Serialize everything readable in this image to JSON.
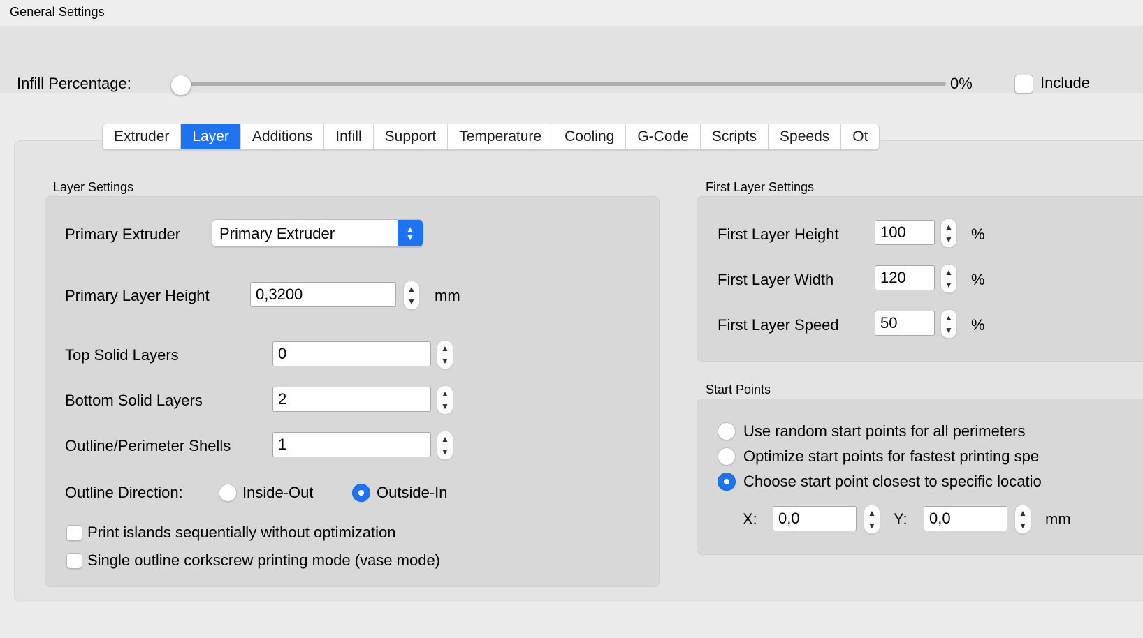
{
  "window": {
    "title": "General Settings"
  },
  "infill": {
    "label": "Infill Percentage:",
    "value_text": "0%",
    "value": 0,
    "min": 0,
    "max": 100,
    "include_label": "Include",
    "include_checked": false
  },
  "tabs": {
    "active": "Layer",
    "items": [
      {
        "label": "Extruder"
      },
      {
        "label": "Layer"
      },
      {
        "label": "Additions"
      },
      {
        "label": "Infill"
      },
      {
        "label": "Support"
      },
      {
        "label": "Temperature"
      },
      {
        "label": "Cooling"
      },
      {
        "label": "G-Code"
      },
      {
        "label": "Scripts"
      },
      {
        "label": "Speeds"
      },
      {
        "label": "Ot"
      }
    ]
  },
  "layer_settings": {
    "caption": "Layer Settings",
    "primary_extruder": {
      "label": "Primary Extruder",
      "value": "Primary Extruder"
    },
    "primary_layer_height": {
      "label": "Primary Layer Height",
      "value": "0,3200",
      "unit": "mm"
    },
    "top_solid_layers": {
      "label": "Top Solid Layers",
      "value": "0"
    },
    "bottom_solid_layers": {
      "label": "Bottom Solid Layers",
      "value": "2"
    },
    "outline_perimeter_shells": {
      "label": "Outline/Perimeter Shells",
      "value": "1"
    },
    "outline_direction": {
      "label": "Outline Direction:",
      "options": [
        "Inside-Out",
        "Outside-In"
      ],
      "selected": "Outside-In"
    },
    "print_islands": {
      "label": "Print islands sequentially without optimization",
      "checked": false
    },
    "vase_mode": {
      "label": "Single outline corkscrew printing mode (vase mode)",
      "checked": false
    }
  },
  "first_layer_settings": {
    "caption": "First Layer Settings",
    "rows": [
      {
        "label": "First Layer Height",
        "value": "100",
        "unit": "%"
      },
      {
        "label": "First Layer Width",
        "value": "120",
        "unit": "%"
      },
      {
        "label": "First Layer Speed",
        "value": "50",
        "unit": "%"
      }
    ]
  },
  "start_points": {
    "caption": "Start Points",
    "options": [
      {
        "label": "Use random start points for all perimeters",
        "selected": false
      },
      {
        "label": "Optimize start points for fastest printing spe",
        "selected": false
      },
      {
        "label": "Choose start point closest to specific locatio",
        "selected": true
      }
    ],
    "x": {
      "label": "X:",
      "value": "0,0"
    },
    "y": {
      "label": "Y:",
      "value": "0,0"
    },
    "unit": "mm"
  },
  "colors": {
    "accent": "#2073f0",
    "window_bg": "#ececec",
    "band_bg": "#e2e2e2",
    "pane_bg": "#e4e4e4",
    "group_bg": "#d8d8d8"
  }
}
